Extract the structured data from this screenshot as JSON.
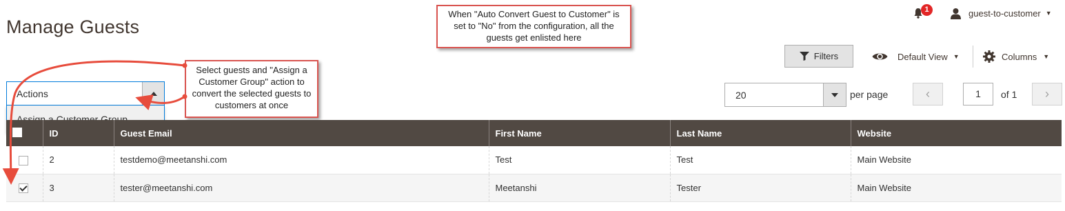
{
  "page": {
    "title": "Manage Guests"
  },
  "header": {
    "notification_count": "1",
    "user_name": "guest-to-customer"
  },
  "callouts": {
    "top": "When \"Auto Convert Guest to Customer\" is set to \"No\" from the configuration, all the guests get enlisted here",
    "left": "Select guests and \"Assign a Customer Group\" action to convert the selected guests to customers at once"
  },
  "toolbar": {
    "filters_label": "Filters",
    "view_label": "Default View",
    "columns_label": "Columns"
  },
  "actions": {
    "label": "Actions",
    "menu": [
      "Assign a Customer Group"
    ]
  },
  "pager": {
    "per_page_value": "20",
    "per_page_label": "per page",
    "current_page": "1",
    "of_label": "of 1"
  },
  "grid": {
    "columns": [
      "ID",
      "Guest Email",
      "First Name",
      "Last Name",
      "Website"
    ],
    "rows": [
      {
        "checked": false,
        "id": "2",
        "email": "testdemo@meetanshi.com",
        "first_name": "Test",
        "last_name": "Test",
        "website": "Main Website"
      },
      {
        "checked": true,
        "id": "3",
        "email": "tester@meetanshi.com",
        "first_name": "Meetanshi",
        "last_name": "Tester",
        "website": "Main Website"
      }
    ]
  },
  "colors": {
    "header_bg": "#514943",
    "accent_red": "#e22626",
    "callout_border": "#d9534f",
    "focus_border": "#007bdb"
  }
}
